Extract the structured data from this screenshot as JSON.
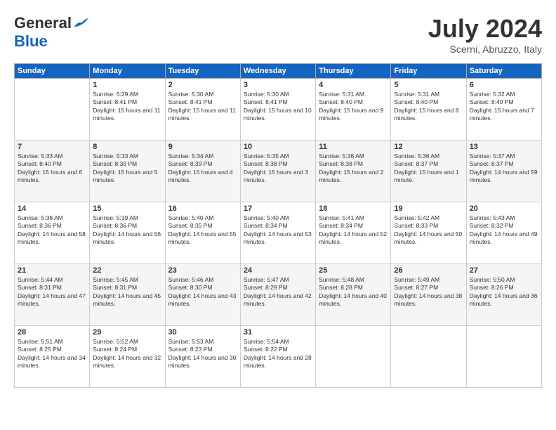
{
  "header": {
    "logo_general": "General",
    "logo_blue": "Blue",
    "month_title": "July 2024",
    "location": "Scerni, Abruzzo, Italy"
  },
  "weekdays": [
    "Sunday",
    "Monday",
    "Tuesday",
    "Wednesday",
    "Thursday",
    "Friday",
    "Saturday"
  ],
  "weeks": [
    [
      {
        "day": "",
        "empty": true
      },
      {
        "day": "1",
        "sunrise": "Sunrise: 5:29 AM",
        "sunset": "Sunset: 8:41 PM",
        "daylight": "Daylight: 15 hours and 11 minutes."
      },
      {
        "day": "2",
        "sunrise": "Sunrise: 5:30 AM",
        "sunset": "Sunset: 8:41 PM",
        "daylight": "Daylight: 15 hours and 11 minutes."
      },
      {
        "day": "3",
        "sunrise": "Sunrise: 5:30 AM",
        "sunset": "Sunset: 8:41 PM",
        "daylight": "Daylight: 15 hours and 10 minutes."
      },
      {
        "day": "4",
        "sunrise": "Sunrise: 5:31 AM",
        "sunset": "Sunset: 8:40 PM",
        "daylight": "Daylight: 15 hours and 9 minutes."
      },
      {
        "day": "5",
        "sunrise": "Sunrise: 5:31 AM",
        "sunset": "Sunset: 8:40 PM",
        "daylight": "Daylight: 15 hours and 8 minutes."
      },
      {
        "day": "6",
        "sunrise": "Sunrise: 5:32 AM",
        "sunset": "Sunset: 8:40 PM",
        "daylight": "Daylight: 15 hours and 7 minutes."
      }
    ],
    [
      {
        "day": "7",
        "sunrise": "Sunrise: 5:33 AM",
        "sunset": "Sunset: 8:40 PM",
        "daylight": "Daylight: 15 hours and 6 minutes."
      },
      {
        "day": "8",
        "sunrise": "Sunrise: 5:33 AM",
        "sunset": "Sunset: 8:39 PM",
        "daylight": "Daylight: 15 hours and 5 minutes."
      },
      {
        "day": "9",
        "sunrise": "Sunrise: 5:34 AM",
        "sunset": "Sunset: 8:39 PM",
        "daylight": "Daylight: 15 hours and 4 minutes."
      },
      {
        "day": "10",
        "sunrise": "Sunrise: 5:35 AM",
        "sunset": "Sunset: 8:38 PM",
        "daylight": "Daylight: 15 hours and 3 minutes."
      },
      {
        "day": "11",
        "sunrise": "Sunrise: 5:36 AM",
        "sunset": "Sunset: 8:38 PM",
        "daylight": "Daylight: 15 hours and 2 minutes."
      },
      {
        "day": "12",
        "sunrise": "Sunrise: 5:36 AM",
        "sunset": "Sunset: 8:37 PM",
        "daylight": "Daylight: 15 hours and 1 minute."
      },
      {
        "day": "13",
        "sunrise": "Sunrise: 5:37 AM",
        "sunset": "Sunset: 8:37 PM",
        "daylight": "Daylight: 14 hours and 59 minutes."
      }
    ],
    [
      {
        "day": "14",
        "sunrise": "Sunrise: 5:38 AM",
        "sunset": "Sunset: 8:36 PM",
        "daylight": "Daylight: 14 hours and 58 minutes."
      },
      {
        "day": "15",
        "sunrise": "Sunrise: 5:39 AM",
        "sunset": "Sunset: 8:36 PM",
        "daylight": "Daylight: 14 hours and 56 minutes."
      },
      {
        "day": "16",
        "sunrise": "Sunrise: 5:40 AM",
        "sunset": "Sunset: 8:35 PM",
        "daylight": "Daylight: 14 hours and 55 minutes."
      },
      {
        "day": "17",
        "sunrise": "Sunrise: 5:40 AM",
        "sunset": "Sunset: 8:34 PM",
        "daylight": "Daylight: 14 hours and 53 minutes."
      },
      {
        "day": "18",
        "sunrise": "Sunrise: 5:41 AM",
        "sunset": "Sunset: 8:34 PM",
        "daylight": "Daylight: 14 hours and 52 minutes."
      },
      {
        "day": "19",
        "sunrise": "Sunrise: 5:42 AM",
        "sunset": "Sunset: 8:33 PM",
        "daylight": "Daylight: 14 hours and 50 minutes."
      },
      {
        "day": "20",
        "sunrise": "Sunrise: 5:43 AM",
        "sunset": "Sunset: 8:32 PM",
        "daylight": "Daylight: 14 hours and 49 minutes."
      }
    ],
    [
      {
        "day": "21",
        "sunrise": "Sunrise: 5:44 AM",
        "sunset": "Sunset: 8:31 PM",
        "daylight": "Daylight: 14 hours and 47 minutes."
      },
      {
        "day": "22",
        "sunrise": "Sunrise: 5:45 AM",
        "sunset": "Sunset: 8:31 PM",
        "daylight": "Daylight: 14 hours and 45 minutes."
      },
      {
        "day": "23",
        "sunrise": "Sunrise: 5:46 AM",
        "sunset": "Sunset: 8:30 PM",
        "daylight": "Daylight: 14 hours and 43 minutes."
      },
      {
        "day": "24",
        "sunrise": "Sunrise: 5:47 AM",
        "sunset": "Sunset: 8:29 PM",
        "daylight": "Daylight: 14 hours and 42 minutes."
      },
      {
        "day": "25",
        "sunrise": "Sunrise: 5:48 AM",
        "sunset": "Sunset: 8:28 PM",
        "daylight": "Daylight: 14 hours and 40 minutes."
      },
      {
        "day": "26",
        "sunrise": "Sunrise: 5:49 AM",
        "sunset": "Sunset: 8:27 PM",
        "daylight": "Daylight: 14 hours and 38 minutes."
      },
      {
        "day": "27",
        "sunrise": "Sunrise: 5:50 AM",
        "sunset": "Sunset: 8:26 PM",
        "daylight": "Daylight: 14 hours and 36 minutes."
      }
    ],
    [
      {
        "day": "28",
        "sunrise": "Sunrise: 5:51 AM",
        "sunset": "Sunset: 8:25 PM",
        "daylight": "Daylight: 14 hours and 34 minutes."
      },
      {
        "day": "29",
        "sunrise": "Sunrise: 5:52 AM",
        "sunset": "Sunset: 8:24 PM",
        "daylight": "Daylight: 14 hours and 32 minutes."
      },
      {
        "day": "30",
        "sunrise": "Sunrise: 5:53 AM",
        "sunset": "Sunset: 8:23 PM",
        "daylight": "Daylight: 14 hours and 30 minutes."
      },
      {
        "day": "31",
        "sunrise": "Sunrise: 5:54 AM",
        "sunset": "Sunset: 8:22 PM",
        "daylight": "Daylight: 14 hours and 28 minutes."
      },
      {
        "day": "",
        "empty": true
      },
      {
        "day": "",
        "empty": true
      },
      {
        "day": "",
        "empty": true
      }
    ]
  ]
}
